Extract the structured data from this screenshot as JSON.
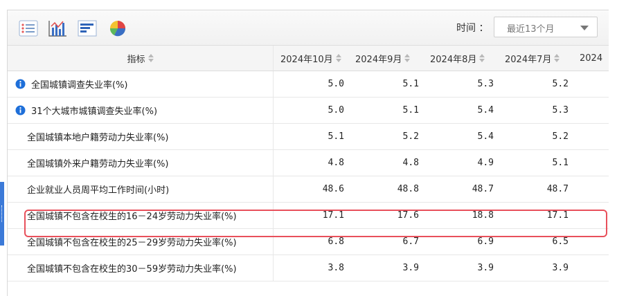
{
  "toolbar": {
    "icons": [
      "list-view-icon",
      "bar-chart-icon",
      "horizontal-bar-icon",
      "pie-chart-icon"
    ],
    "time_label": "时间 ：",
    "time_select_value": "最近13个月"
  },
  "table": {
    "header_indicator": "指标",
    "columns": [
      "2024年10月",
      "2024年9月",
      "2024年8月",
      "2024年7月",
      "2024"
    ],
    "rows": [
      {
        "name": "全国城镇调查失业率(%)",
        "info": true,
        "values": [
          "5.0",
          "5.1",
          "5.3",
          "5.2"
        ]
      },
      {
        "name": "31个大城市城镇调查失业率(%)",
        "info": true,
        "values": [
          "5.0",
          "5.1",
          "5.4",
          "5.3"
        ]
      },
      {
        "name": "全国城镇本地户籍劳动力失业率(%)",
        "info": false,
        "values": [
          "5.1",
          "5.2",
          "5.4",
          "5.2"
        ]
      },
      {
        "name": "全国城镇外来户籍劳动力失业率(%)",
        "info": false,
        "values": [
          "4.8",
          "4.8",
          "4.9",
          "5.1"
        ]
      },
      {
        "name": "企业就业人员周平均工作时间(小时)",
        "info": false,
        "values": [
          "48.6",
          "48.8",
          "48.7",
          "48.7"
        ]
      },
      {
        "name": "全国城镇不包含在校生的16－24岁劳动力失业率(%)",
        "info": false,
        "values": [
          "17.1",
          "17.6",
          "18.8",
          "17.1"
        ]
      },
      {
        "name": "全国城镇不包含在校生的25－29岁劳动力失业率(%)",
        "info": false,
        "values": [
          "6.8",
          "6.7",
          "6.9",
          "6.5"
        ]
      },
      {
        "name": "全国城镇不包含在校生的30－59岁劳动力失业率(%)",
        "info": false,
        "values": [
          "3.8",
          "3.9",
          "3.9",
          "3.9"
        ]
      }
    ]
  },
  "colors": {
    "accent": "#3c7ad8",
    "highlight_border": "#e8505b",
    "info_icon": "#1e6fd9"
  }
}
